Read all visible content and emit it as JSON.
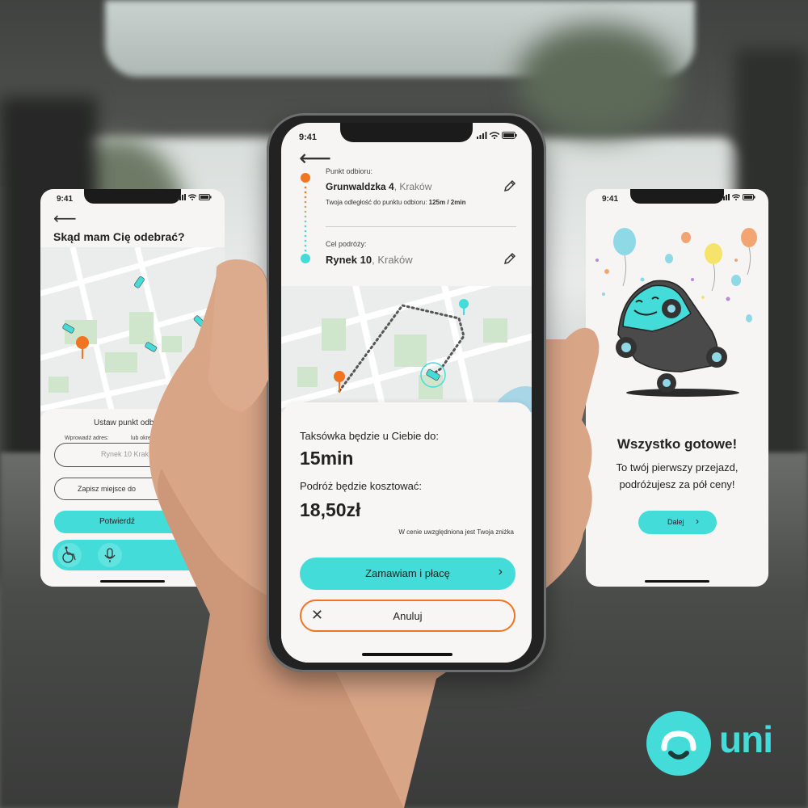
{
  "colors": {
    "accent": "#44dcd9",
    "orange": "#f07421",
    "sheet": "#f7f6f4"
  },
  "left_screen": {
    "time": "9:41",
    "title": "Skąd mam Cię odebrać?",
    "sheet_title": "Ustaw punkt odbioru",
    "address_label": "Wprowadź adres:",
    "locate_label": "lub określ",
    "address_value": "Rynek 10 Krak",
    "save_place": "Zapisz miejsce do",
    "confirm": "Potwierdź"
  },
  "center_screen": {
    "time": "9:41",
    "pickup_label": "Punkt odbioru:",
    "pickup_street": "Grunwaldzka 4",
    "pickup_city": ", Kraków",
    "distance_label": "Twoja odległość do punktu odbioru:",
    "distance_value": "125m / 2min",
    "destination_label": "Cel podróży:",
    "destination_street": "Rynek 10",
    "destination_city": ", Kraków",
    "eta_label": "Taksówka będzie u Ciebie do:",
    "eta_value": "15min",
    "cost_label": "Podróż  będzie kosztować:",
    "cost_value": "18,50zł",
    "discount_note": "W cenie uwzględniona jest Twoja zniżka",
    "order_button": "Zamawiam i płacę",
    "cancel_button": "Anuluj"
  },
  "right_screen": {
    "time": "9:41",
    "title": "Wszystko gotowe!",
    "line1": "To twój pierwszy przejazd,",
    "line2": "podróżujesz za pół ceny!",
    "next_button": "Dalej"
  },
  "logo": {
    "text": "uni"
  },
  "icons": [
    "back-arrow-icon",
    "edit-pencil-icon",
    "map-pin-icon",
    "taxi-icon",
    "wheelchair-icon",
    "microphone-icon",
    "chevron-right-icon",
    "close-icon",
    "signal-icon",
    "wifi-icon",
    "battery-icon",
    "balloon-icon",
    "car-mascot-icon"
  ]
}
